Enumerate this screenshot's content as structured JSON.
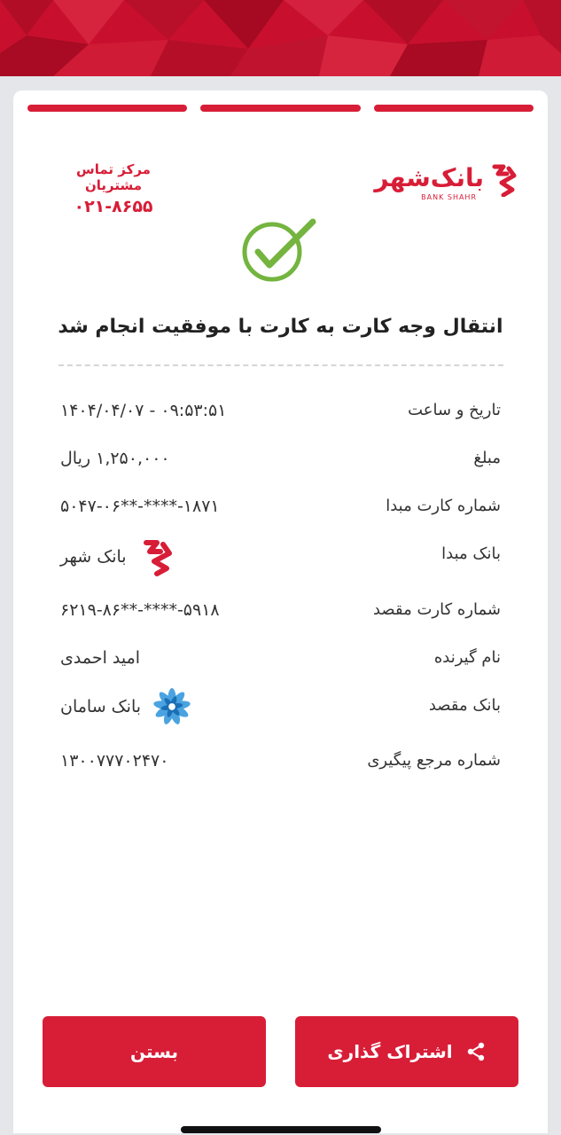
{
  "brand": {
    "name": "بانک‌شهر",
    "latin": "BANK SHAHR",
    "color": "#d81d37"
  },
  "contact": {
    "label": "مرکز تماس مشتریان",
    "phone": "۰۲۱-۸۶۵۵"
  },
  "status": {
    "icon": "check-circle-icon",
    "title": "انتقال وجه کارت به کارت با موفقیت انجام شد"
  },
  "details": {
    "datetime": {
      "label": "تاریخ و ساعت",
      "value": "۱۴۰۴/۰۴/۰۷ - ۰۹:۵۳:۵۱"
    },
    "amount": {
      "label": "مبلغ",
      "value": "۱,۲۵۰,۰۰۰ ریال"
    },
    "source_card": {
      "label": "شماره کارت مبدا",
      "value": "۵۰۴۷-۰۶**-****-۱۸۷۱"
    },
    "source_bank": {
      "label": "بانک مبدا",
      "value": "بانک شهر",
      "icon": "bank-shahr-icon"
    },
    "dest_card": {
      "label": "شماره کارت مقصد",
      "value": "۶۲۱۹-۸۶**-****-۵۹۱۸"
    },
    "recipient": {
      "label": "نام گیرنده",
      "value": "امید احمدی"
    },
    "dest_bank": {
      "label": "بانک مقصد",
      "value": "بانک سامان",
      "icon": "bank-saman-icon"
    },
    "tracking": {
      "label": "شماره مرجع پیگیری",
      "value": "۱۳۰۰۷۷۷۰۲۴۷۰"
    }
  },
  "actions": {
    "share_label": "اشتراک گذاری",
    "close_label": "بستن"
  }
}
